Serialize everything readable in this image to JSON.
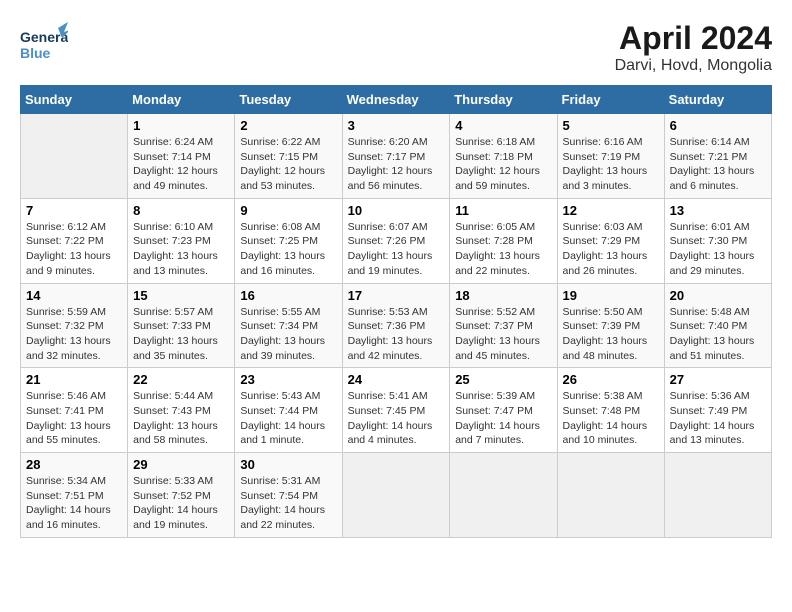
{
  "header": {
    "logo_general": "General",
    "logo_blue": "Blue",
    "title": "April 2024",
    "subtitle": "Darvi, Hovd, Mongolia"
  },
  "columns": [
    "Sunday",
    "Monday",
    "Tuesday",
    "Wednesday",
    "Thursday",
    "Friday",
    "Saturday"
  ],
  "weeks": [
    [
      {
        "num": "",
        "info": ""
      },
      {
        "num": "1",
        "info": "Sunrise: 6:24 AM\nSunset: 7:14 PM\nDaylight: 12 hours\nand 49 minutes."
      },
      {
        "num": "2",
        "info": "Sunrise: 6:22 AM\nSunset: 7:15 PM\nDaylight: 12 hours\nand 53 minutes."
      },
      {
        "num": "3",
        "info": "Sunrise: 6:20 AM\nSunset: 7:17 PM\nDaylight: 12 hours\nand 56 minutes."
      },
      {
        "num": "4",
        "info": "Sunrise: 6:18 AM\nSunset: 7:18 PM\nDaylight: 12 hours\nand 59 minutes."
      },
      {
        "num": "5",
        "info": "Sunrise: 6:16 AM\nSunset: 7:19 PM\nDaylight: 13 hours\nand 3 minutes."
      },
      {
        "num": "6",
        "info": "Sunrise: 6:14 AM\nSunset: 7:21 PM\nDaylight: 13 hours\nand 6 minutes."
      }
    ],
    [
      {
        "num": "7",
        "info": "Sunrise: 6:12 AM\nSunset: 7:22 PM\nDaylight: 13 hours\nand 9 minutes."
      },
      {
        "num": "8",
        "info": "Sunrise: 6:10 AM\nSunset: 7:23 PM\nDaylight: 13 hours\nand 13 minutes."
      },
      {
        "num": "9",
        "info": "Sunrise: 6:08 AM\nSunset: 7:25 PM\nDaylight: 13 hours\nand 16 minutes."
      },
      {
        "num": "10",
        "info": "Sunrise: 6:07 AM\nSunset: 7:26 PM\nDaylight: 13 hours\nand 19 minutes."
      },
      {
        "num": "11",
        "info": "Sunrise: 6:05 AM\nSunset: 7:28 PM\nDaylight: 13 hours\nand 22 minutes."
      },
      {
        "num": "12",
        "info": "Sunrise: 6:03 AM\nSunset: 7:29 PM\nDaylight: 13 hours\nand 26 minutes."
      },
      {
        "num": "13",
        "info": "Sunrise: 6:01 AM\nSunset: 7:30 PM\nDaylight: 13 hours\nand 29 minutes."
      }
    ],
    [
      {
        "num": "14",
        "info": "Sunrise: 5:59 AM\nSunset: 7:32 PM\nDaylight: 13 hours\nand 32 minutes."
      },
      {
        "num": "15",
        "info": "Sunrise: 5:57 AM\nSunset: 7:33 PM\nDaylight: 13 hours\nand 35 minutes."
      },
      {
        "num": "16",
        "info": "Sunrise: 5:55 AM\nSunset: 7:34 PM\nDaylight: 13 hours\nand 39 minutes."
      },
      {
        "num": "17",
        "info": "Sunrise: 5:53 AM\nSunset: 7:36 PM\nDaylight: 13 hours\nand 42 minutes."
      },
      {
        "num": "18",
        "info": "Sunrise: 5:52 AM\nSunset: 7:37 PM\nDaylight: 13 hours\nand 45 minutes."
      },
      {
        "num": "19",
        "info": "Sunrise: 5:50 AM\nSunset: 7:39 PM\nDaylight: 13 hours\nand 48 minutes."
      },
      {
        "num": "20",
        "info": "Sunrise: 5:48 AM\nSunset: 7:40 PM\nDaylight: 13 hours\nand 51 minutes."
      }
    ],
    [
      {
        "num": "21",
        "info": "Sunrise: 5:46 AM\nSunset: 7:41 PM\nDaylight: 13 hours\nand 55 minutes."
      },
      {
        "num": "22",
        "info": "Sunrise: 5:44 AM\nSunset: 7:43 PM\nDaylight: 13 hours\nand 58 minutes."
      },
      {
        "num": "23",
        "info": "Sunrise: 5:43 AM\nSunset: 7:44 PM\nDaylight: 14 hours\nand 1 minute."
      },
      {
        "num": "24",
        "info": "Sunrise: 5:41 AM\nSunset: 7:45 PM\nDaylight: 14 hours\nand 4 minutes."
      },
      {
        "num": "25",
        "info": "Sunrise: 5:39 AM\nSunset: 7:47 PM\nDaylight: 14 hours\nand 7 minutes."
      },
      {
        "num": "26",
        "info": "Sunrise: 5:38 AM\nSunset: 7:48 PM\nDaylight: 14 hours\nand 10 minutes."
      },
      {
        "num": "27",
        "info": "Sunrise: 5:36 AM\nSunset: 7:49 PM\nDaylight: 14 hours\nand 13 minutes."
      }
    ],
    [
      {
        "num": "28",
        "info": "Sunrise: 5:34 AM\nSunset: 7:51 PM\nDaylight: 14 hours\nand 16 minutes."
      },
      {
        "num": "29",
        "info": "Sunrise: 5:33 AM\nSunset: 7:52 PM\nDaylight: 14 hours\nand 19 minutes."
      },
      {
        "num": "30",
        "info": "Sunrise: 5:31 AM\nSunset: 7:54 PM\nDaylight: 14 hours\nand 22 minutes."
      },
      {
        "num": "",
        "info": ""
      },
      {
        "num": "",
        "info": ""
      },
      {
        "num": "",
        "info": ""
      },
      {
        "num": "",
        "info": ""
      }
    ]
  ]
}
